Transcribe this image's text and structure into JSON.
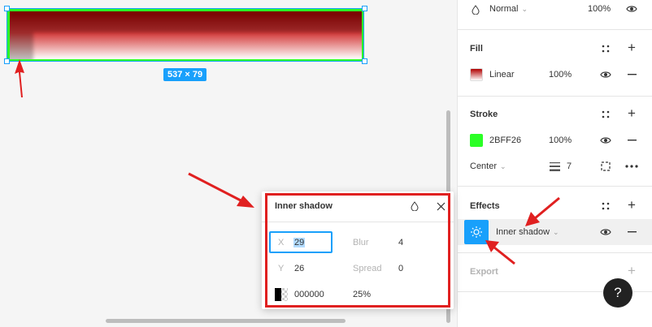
{
  "canvas": {
    "size_badge": "537 × 79",
    "rect_stroke_color": "#2BFF26",
    "selection_color": "#18a0fb"
  },
  "layer": {
    "blend_mode": "Normal",
    "opacity": "100%"
  },
  "fill": {
    "title": "Fill",
    "type": "Linear",
    "opacity": "100%"
  },
  "stroke": {
    "title": "Stroke",
    "color_hex": "2BFF26",
    "opacity": "100%",
    "align": "Center",
    "weight": "7"
  },
  "effects": {
    "title": "Effects",
    "type": "Inner shadow"
  },
  "export": {
    "title": "Export"
  },
  "dialog": {
    "title": "Inner shadow",
    "x_label": "X",
    "x_value": "29",
    "y_label": "Y",
    "y_value": "26",
    "blur_label": "Blur",
    "blur_value": "4",
    "spread_label": "Spread",
    "spread_value": "0",
    "color_hex": "000000",
    "color_opacity": "25%"
  },
  "help": {
    "label": "?"
  },
  "colors": {
    "accent": "#18a0fb",
    "annotation": "#e02020",
    "stroke": "#2BFF26"
  }
}
